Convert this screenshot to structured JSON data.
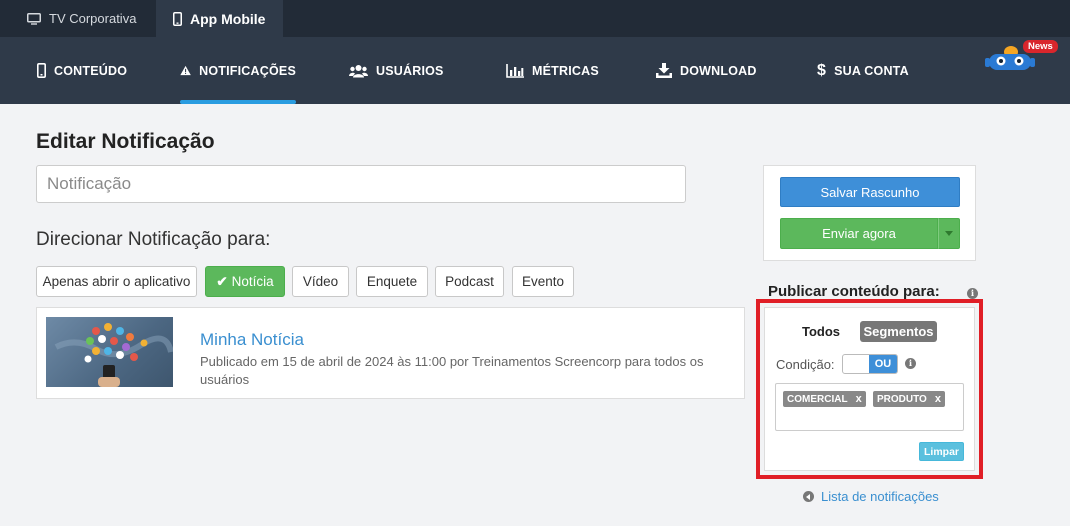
{
  "platform_tabs": [
    {
      "label": "TV Corporativa",
      "icon": "monitor-icon"
    },
    {
      "label": "App Mobile",
      "icon": "mobile-icon",
      "active": true
    }
  ],
  "nav": {
    "items": [
      {
        "label": "CONTEÚDO",
        "icon": "mobile-icon"
      },
      {
        "label": "NOTIFICAÇÕES",
        "icon": "warning-icon",
        "active": true
      },
      {
        "label": "USUÁRIOS",
        "icon": "users-icon"
      },
      {
        "label": "MÉTRICAS",
        "icon": "bar-chart-icon"
      },
      {
        "label": "DOWNLOAD",
        "icon": "download-icon"
      },
      {
        "label": "SUA CONTA",
        "icon": "dollar-icon"
      }
    ],
    "news_badge": "News"
  },
  "editor": {
    "title": "Editar Notificação",
    "input_placeholder": "Notificação",
    "input_value": "",
    "direct_label": "Direcionar Notificação para:",
    "types": [
      {
        "label": "Apenas abrir o aplicativo"
      },
      {
        "label": "Notícia",
        "active": true
      },
      {
        "label": "Vídeo"
      },
      {
        "label": "Enquete"
      },
      {
        "label": "Podcast"
      },
      {
        "label": "Evento"
      }
    ],
    "selected_item": {
      "title": "Minha Notícia",
      "meta": "Publicado em 15 de abril de 2024 às 11:00 por Treinamentos Screencorp para todos os usuários"
    }
  },
  "actions": {
    "save_label": "Salvar Rascunho",
    "send_label": "Enviar agora"
  },
  "publish": {
    "title": "Publicar conteúdo para:",
    "option_all": "Todos",
    "option_segments": "Segmentos",
    "condition_label": "Condição:",
    "condition_value": "OU",
    "tags": [
      "COMERCIAL",
      "PRODUTO"
    ],
    "tag_remove": "x",
    "clear_label": "Limpar"
  },
  "list_link": "Lista de notificações",
  "colors": {
    "topbar": "#222b37",
    "navbar": "#2f3a49",
    "nav_active_underline": "#2a9ce0",
    "primary": "#3e8fd8",
    "success": "#5cb85c",
    "highlight": "#e01e26",
    "link": "#3a8fd0"
  }
}
